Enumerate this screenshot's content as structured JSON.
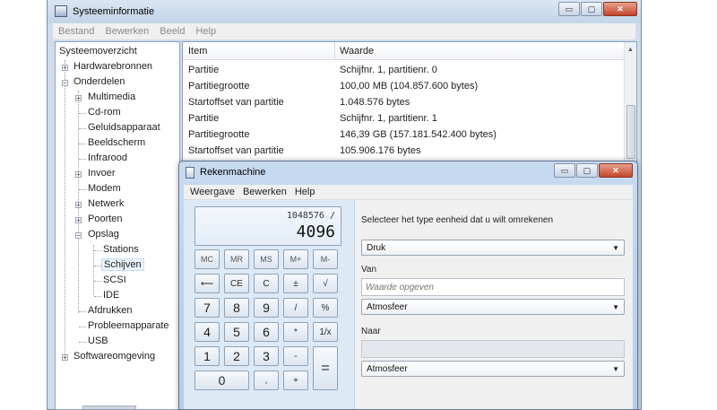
{
  "sysinfo": {
    "title": "Systeeminformatie",
    "window_buttons": {
      "minimize": "▭",
      "maximize": "▢",
      "close": "✕"
    },
    "menu": [
      "Bestand",
      "Bewerken",
      "Beeld",
      "Help"
    ],
    "tree": {
      "root": "Systeemoverzicht",
      "hardwarebronnen": "Hardwarebronnen",
      "onderdelen": "Onderdelen",
      "multimedia": "Multimedia",
      "cdrom": "Cd-rom",
      "geluidsapparaat": "Geluidsapparaat",
      "beeldscherm": "Beeldscherm",
      "infrarood": "Infrarood",
      "invoer": "Invoer",
      "modem": "Modem",
      "netwerk": "Netwerk",
      "poorten": "Poorten",
      "opslag": "Opslag",
      "stations": "Stations",
      "schijven": "Schijven",
      "scsi": "SCSI",
      "ide": "IDE",
      "afdrukken": "Afdrukken",
      "probleemapparaten": "Probleemapparate",
      "usb": "USB",
      "softwareomgeving": "Softwareomgeving"
    },
    "expanders": {
      "plus": "+",
      "minus": "−"
    },
    "list": {
      "col_item": "Item",
      "col_value": "Waarde",
      "rows": [
        {
          "item": "Partitie",
          "value": "Schijfnr. 1, partitienr. 0"
        },
        {
          "item": "Partitiegrootte",
          "value": "100,00 MB (104.857.600 bytes)"
        },
        {
          "item": "Startoffset van partitie",
          "value": "1.048.576 bytes"
        },
        {
          "item": "Partitie",
          "value": "Schijfnr. 1, partitienr. 1"
        },
        {
          "item": "Partitiegrootte",
          "value": "146,39 GB (157.181.542.400 bytes)"
        },
        {
          "item": "Startoffset van partitie",
          "value": "105.906.176 bytes"
        }
      ],
      "scroll_up": "▲"
    }
  },
  "calc": {
    "title": "Rekenmachine",
    "window_buttons": {
      "minimize": "▭",
      "maximize": "▢",
      "close": "✕"
    },
    "menu": [
      "Weergave",
      "Bewerken",
      "Help"
    ],
    "display": {
      "expression": "1048576 /",
      "value": "4096"
    },
    "keys": {
      "mc": "MC",
      "mr": "MR",
      "ms": "MS",
      "mplus": "M+",
      "mminus": "M-",
      "back": "⟵",
      "ce": "CE",
      "c": "C",
      "plusminus": "±",
      "sqrt": "√",
      "k7": "7",
      "k8": "8",
      "k9": "9",
      "div": "/",
      "pct": "%",
      "k4": "4",
      "k5": "5",
      "k6": "6",
      "mul": "*",
      "recip": "1/x",
      "k1": "1",
      "k2": "2",
      "k3": "3",
      "sub": "-",
      "eq": "=",
      "k0": "0",
      "dot": ",",
      "add": "+"
    },
    "converter": {
      "heading": "Selecteer het type eenheid dat u wilt omrekenen",
      "type_value": "Druk",
      "from_label": "Van",
      "from_placeholder": "Waarde opgeven",
      "from_unit": "Atmosfeer",
      "to_label": "Naar",
      "to_unit": "Atmosfeer",
      "dropdown_arrow": "▼"
    }
  }
}
